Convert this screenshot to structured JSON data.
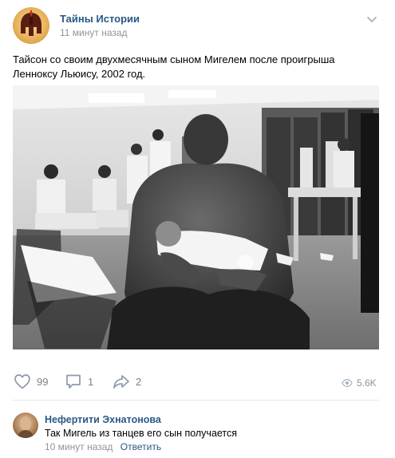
{
  "post": {
    "group_name": "Тайны Истории",
    "time": "11 минут назад",
    "text": "Тайсон со своим двухмесячным сыном Мигелем после проигрыша Ленноксу Льюису, 2002 год.",
    "photo_icon": "photo"
  },
  "actions": {
    "likes": "99",
    "comments": "1",
    "shares": "2",
    "views": "5.6K"
  },
  "comment": {
    "author": "Нефертити Эхнатонова",
    "text": "Так Мигель из танцев его сын получается",
    "time": "10 минут назад",
    "reply_label": "Ответить"
  },
  "colors": {
    "link": "#2a5885",
    "muted": "#939393",
    "count": "#828282"
  }
}
